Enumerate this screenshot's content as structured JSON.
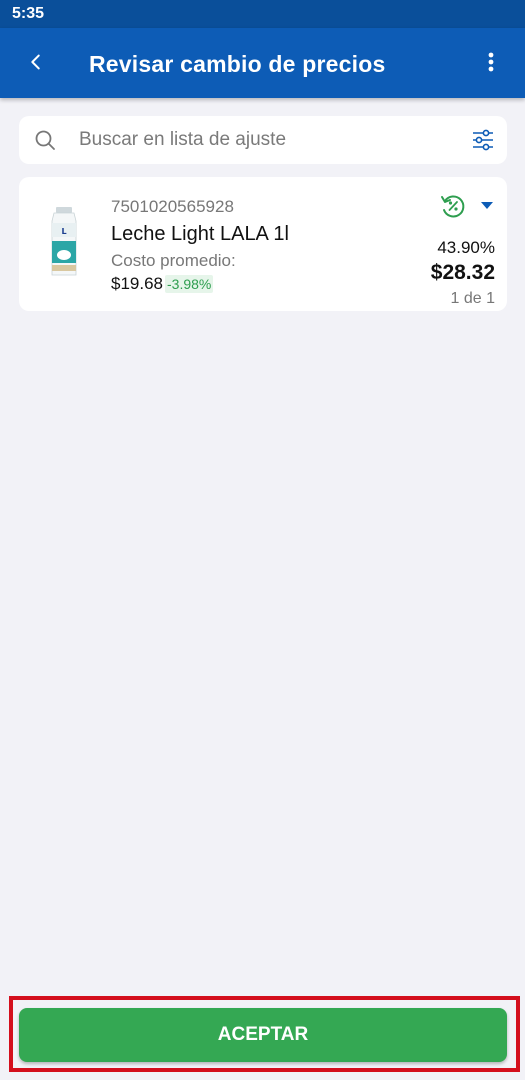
{
  "status_bar": {
    "time": "5:35"
  },
  "header": {
    "title": "Revisar cambio de precios",
    "back_icon": "chevron-left-icon",
    "more_icon": "more-vertical-icon"
  },
  "search": {
    "placeholder": "Buscar en lista de ajuste",
    "value": "",
    "icon": "search-icon",
    "filter_icon": "sliders-icon"
  },
  "items": [
    {
      "barcode": "7501020565928",
      "name": "Leche Light LALA 1l",
      "cost_label": "Costo promedio:",
      "cost": "$19.68",
      "cost_change": "-3.98%",
      "margin": "43.90%",
      "price": "$28.32",
      "count": "1 de 1",
      "status_icon": "discount-refresh-icon",
      "dropdown_icon": "caret-down-icon"
    }
  ],
  "footer": {
    "accept_label": "ACEPTAR"
  },
  "colors": {
    "primary": "#0d5cb6",
    "status_bar": "#0a4f9a",
    "accent_green": "#34a853",
    "highlight_red": "#d40f1d",
    "background": "#f2f2f7"
  }
}
